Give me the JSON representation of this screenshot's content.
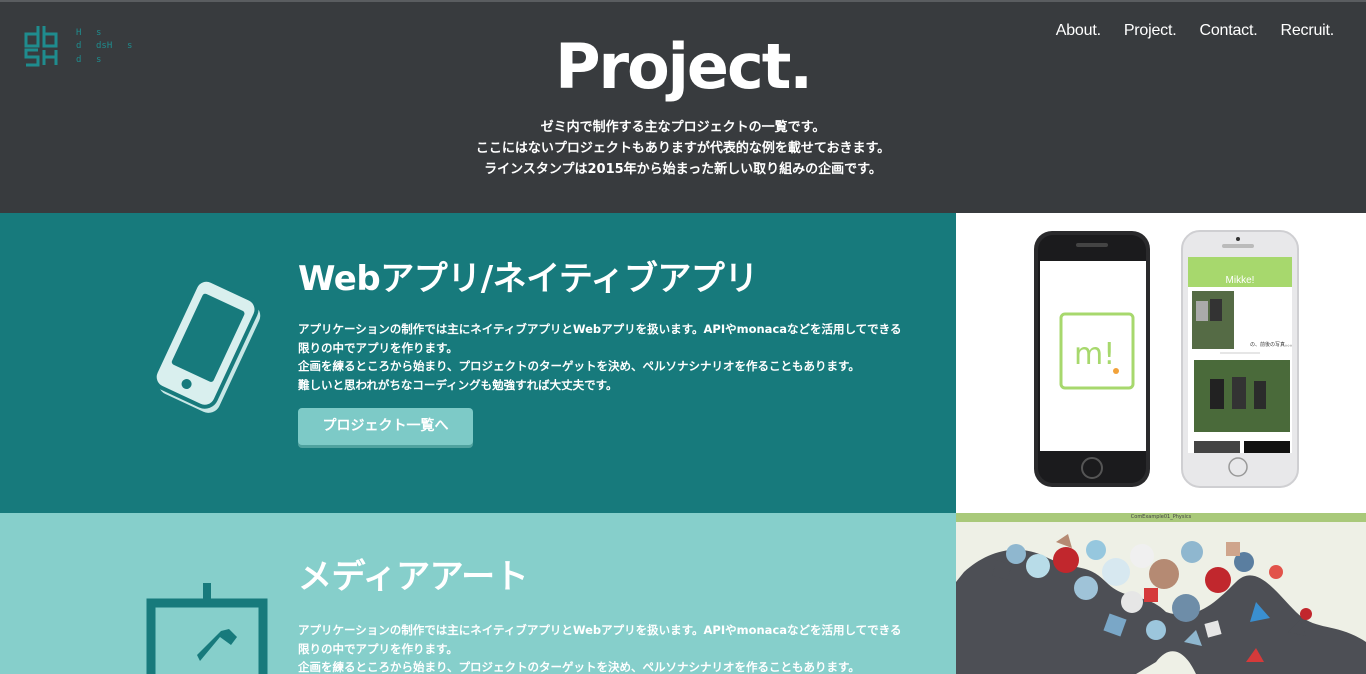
{
  "logo": {
    "letters": [
      "d",
      "b",
      "S",
      "H"
    ],
    "small": [
      "H",
      "s",
      "d",
      "dsH",
      "s",
      "d",
      "s"
    ]
  },
  "nav": {
    "items": [
      "About.",
      "Project.",
      "Contact.",
      "Recruit."
    ]
  },
  "hero": {
    "title": "Project.",
    "lines": [
      "ゼミ内で制作する主なプロジェクトの一覧です。",
      "ここにはないプロジェクトもありますが代表的な例を載せておきます。",
      "ラインスタンプは2015年から始まった新しい取り組みの企画です。"
    ]
  },
  "sections": [
    {
      "title": "Webアプリ/ネイティブアプリ",
      "text": [
        "アプリケーションの制作では主にネイティブアプリとWebアプリを扱います。APIやmonacaなどを活用してできる",
        "限りの中でアプリを作ります。",
        "企画を練るところから始まり、プロジェクトのターゲットを決め、ペルソナシナリオを作ることもあります。",
        "難しいと思われがちなコーディングも勉強すれば大丈夫です。"
      ],
      "button": "プロジェクト一覧へ",
      "screenshot": {
        "app_title": "Mikke!",
        "logo_text": "m!",
        "caption": "の、前後の写真。。。"
      }
    },
    {
      "title": "メディアアート",
      "text": [
        "アプリケーションの制作では主にネイティブアプリとWebアプリを扱います。APIやmonacaなどを活用してできる",
        "限りの中でアプリを作ります。",
        "企画を練るところから始まり、プロジェクトのターゲットを決め、ペルソナシナリオを作ることもあります。"
      ],
      "screenshot": {
        "bar_label": "ComExample01_Physics"
      }
    }
  ],
  "colors": {
    "header_bg": "#383b3e",
    "section1_bg": "#177a7c",
    "section2_bg": "#86cfcb",
    "button_bg": "#7dcac7",
    "logo_teal": "#1f8c8e",
    "app_green": "#a7d86d"
  }
}
